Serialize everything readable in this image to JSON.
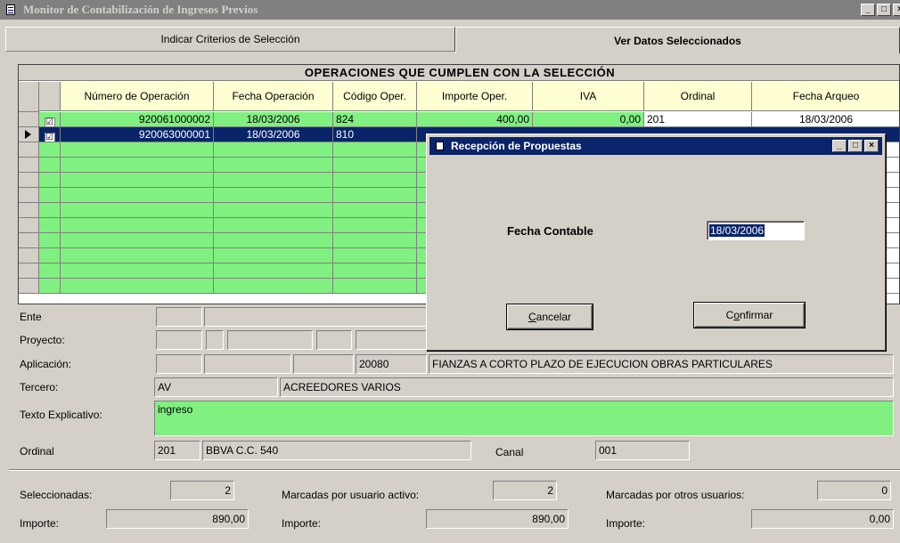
{
  "window": {
    "title": "Monitor de Contabilización de Ingresos Previos"
  },
  "tabs": [
    {
      "label": "Indicar Criterios de Selección",
      "selected": false
    },
    {
      "label": "Ver Datos Seleccionados",
      "selected": true
    }
  ],
  "grid": {
    "title": "OPERACIONES QUE CUMPLEN CON LA SELECCIÓN",
    "columns": [
      "Número de Operación",
      "Fecha Operación",
      "Código Oper.",
      "Importe Oper.",
      "IVA",
      "Ordinal",
      "Fecha Arqueo"
    ],
    "rows": [
      {
        "checked": "☑",
        "numero": "920061000002",
        "fecha": "18/03/2006",
        "codigo": "824",
        "importe": "400,00",
        "iva": "0,00",
        "ordinal": "201",
        "arqueo": "18/03/2006"
      },
      {
        "checked": "☑",
        "numero": "920063000001",
        "fecha": "18/03/2006",
        "codigo": "810"
      }
    ]
  },
  "form": {
    "ente_label": "Ente",
    "proyecto_label": "Proyecto:",
    "aplicacion_label": "Aplicación:",
    "aplicacion_code": "20080",
    "aplicacion_desc": "FIANZAS A CORTO PLAZO DE EJECUCION OBRAS PARTICULARES",
    "tercero_label": "Tercero:",
    "tercero_code": "AV",
    "tercero_desc": "ACREEDORES VARIOS",
    "texto_label": "Texto Explicativo:",
    "texto_value": "ingreso",
    "ordinal_label": "Ordinal",
    "ordinal_code": "201",
    "ordinal_desc": "BBVA C.C. 540",
    "canal_label": "Canal",
    "canal_value": "001"
  },
  "summary": {
    "seleccionadas_label": "Seleccionadas:",
    "seleccionadas_value": "2",
    "marcadas_activo_label": "Marcadas por usuario activo:",
    "marcadas_activo_value": "2",
    "marcadas_otros_label": "Marcadas por otros usuarios:",
    "marcadas_otros_value": "0",
    "importe_label": "Importe:",
    "importe_1": "890,00",
    "importe_2": "890,00",
    "importe_3": "0,00"
  },
  "dialog": {
    "title": "Recepción de Propuestas",
    "fecha_label": "Fecha Contable",
    "fecha_value": "18/03/2006",
    "cancel_label": "ancelar",
    "cancel_accel": "C",
    "confirm_pre": "C",
    "confirm_accel": "o",
    "confirm_post": "nfirmar"
  }
}
